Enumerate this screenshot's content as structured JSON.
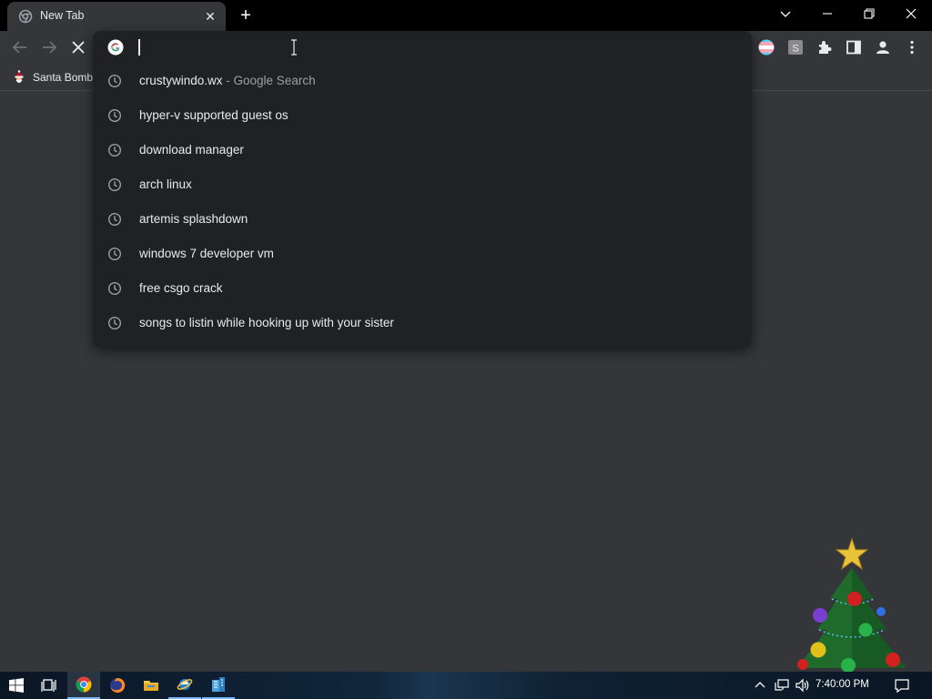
{
  "tab": {
    "title": "New Tab"
  },
  "omnibox": {
    "input_value": "",
    "suggestions": [
      {
        "text": "crustywindo.wx",
        "subtext": " - Google Search"
      },
      {
        "text": "hyper-v supported guest os",
        "subtext": ""
      },
      {
        "text": "download manager",
        "subtext": ""
      },
      {
        "text": "arch linux",
        "subtext": ""
      },
      {
        "text": "artemis splashdown",
        "subtext": ""
      },
      {
        "text": "windows 7 developer vm",
        "subtext": ""
      },
      {
        "text": "free csgo crack",
        "subtext": ""
      },
      {
        "text": "songs to listin while hooking up with your sister",
        "subtext": ""
      }
    ]
  },
  "bookmarks": [
    {
      "label": "Santa Bomb"
    }
  ],
  "extensions": [
    {
      "icon": "profile-flag-icon"
    },
    {
      "icon": "s-extension-icon",
      "label": "S"
    },
    {
      "icon": "puzzle-icon"
    },
    {
      "icon": "side-panel-icon"
    },
    {
      "icon": "profile-icon"
    },
    {
      "icon": "kebab-menu-icon"
    }
  ],
  "taskbar": {
    "time": "7:40:00 PM",
    "apps": [
      "windows-start-icon",
      "task-view-icon",
      "chrome-icon",
      "firefox-icon",
      "file-explorer-icon",
      "internet-explorer-icon",
      "office-buildings-icon"
    ]
  },
  "colors": {
    "frame": "#000000",
    "toolbar": "#35363a",
    "dropdown": "#202124",
    "text": "#e8eaed",
    "subtext": "#9aa0a6"
  }
}
